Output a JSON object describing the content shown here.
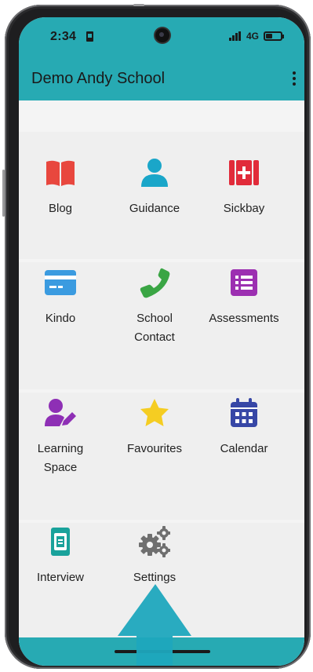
{
  "status_bar": {
    "time": "2:34",
    "network": "4G",
    "battery_level": 0.45
  },
  "app_bar": {
    "title": "Demo Andy School",
    "menu_icon": "more-vertical-icon"
  },
  "grid": {
    "items": [
      {
        "label": "Blog",
        "icon": "book-icon",
        "color": "#e8473e"
      },
      {
        "label": "Guidance",
        "icon": "person-icon",
        "color": "#1aa6c9"
      },
      {
        "label": "Sickbay",
        "icon": "first-aid-kit-icon",
        "color": "#e12b3a"
      },
      {
        "label": "Kindo",
        "icon": "credit-card-icon",
        "color": "#3b9be0"
      },
      {
        "label": "School Contact",
        "icon": "phone-icon",
        "color": "#3aa544"
      },
      {
        "label": "Assessments",
        "icon": "list-icon",
        "color": "#9c2fb1"
      },
      {
        "label": "Learning Space",
        "icon": "user-edit-icon",
        "color": "#8e2fb5"
      },
      {
        "label": "Favourites",
        "icon": "star-icon",
        "color": "#f5cd22"
      },
      {
        "label": "Calendar",
        "icon": "calendar-icon",
        "color": "#3747a6"
      },
      {
        "label": "Interview",
        "icon": "id-badge-icon",
        "color": "#19a29b"
      },
      {
        "label": "Settings",
        "icon": "gears-icon",
        "color": "#6f6f6f"
      }
    ]
  },
  "overlay": {
    "arrow_color": "#1ea6bd"
  }
}
